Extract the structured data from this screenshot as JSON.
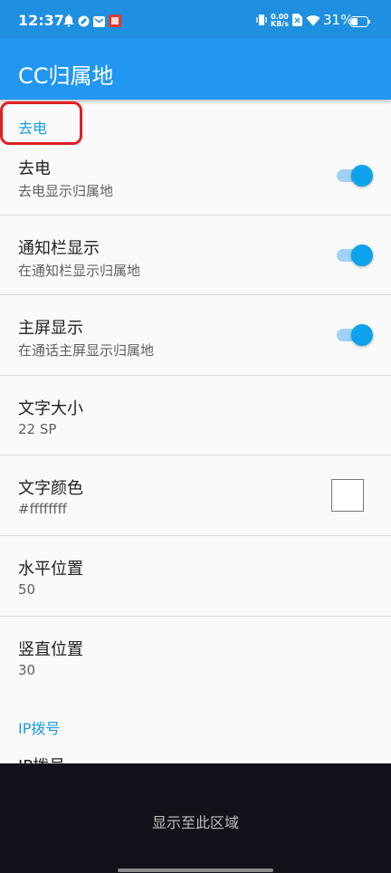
{
  "status_bar": {
    "time": "12:37",
    "network_speed": "0.00",
    "network_unit": "KB/s",
    "battery": "31%",
    "icons": [
      "notification-bell-icon",
      "app-icon",
      "mail-icon",
      "app-badge-icon",
      "vibrate-icon",
      "sim-off-icon",
      "wifi-icon",
      "battery-icon"
    ]
  },
  "app_bar": {
    "title": "CC归属地"
  },
  "sections": [
    {
      "category": "去电",
      "items": [
        {
          "title": "去电",
          "summary": "去电显示归属地",
          "widget": "switch",
          "checked": true
        },
        {
          "title": "通知栏显示",
          "summary": "在通知栏显示归属地",
          "widget": "switch",
          "checked": true
        },
        {
          "title": "主屏显示",
          "summary": "在通话主屏显示归属地",
          "widget": "switch",
          "checked": true
        },
        {
          "title": "文字大小",
          "summary": "22 SP"
        },
        {
          "title": "文字颜色",
          "summary": "#ffffffff",
          "widget": "color",
          "color": "#ffffff"
        },
        {
          "title": "水平位置",
          "summary": "50"
        },
        {
          "title": "竖直位置",
          "summary": "30"
        }
      ]
    },
    {
      "category": "IP拨号",
      "items": [
        {
          "title": "IP拨号"
        }
      ]
    }
  ],
  "overlay": {
    "text": "显示至此区域"
  },
  "colors": {
    "status_bar": "#1f8fe0",
    "app_bar": "#2196f3",
    "accent": "#0ea2ec",
    "highlight": "#e02020"
  }
}
